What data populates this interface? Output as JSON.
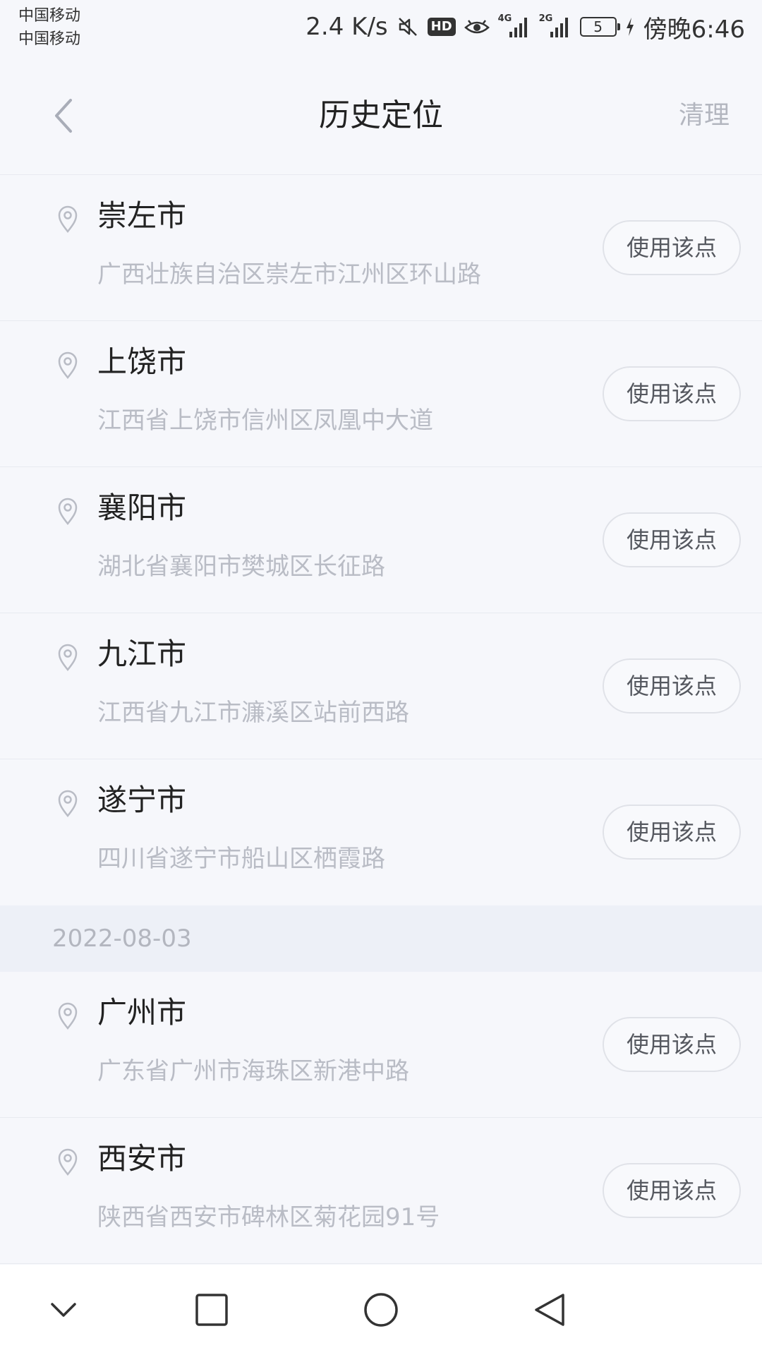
{
  "status_bar": {
    "carrier_1": "中国移动",
    "carrier_2": "中国移动",
    "network_speed": "2.4 K/s",
    "hd_label": "HD",
    "signal_1_label": "4G",
    "signal_2_label": "2G",
    "battery_level": "5",
    "time": "傍晚6:46",
    "icons": [
      "mute-icon",
      "hd-icon",
      "eye-icon",
      "signal-4g-icon",
      "signal-2g-icon",
      "battery-icon",
      "charging-icon"
    ]
  },
  "header": {
    "title": "历史定位",
    "clear_label": "清理",
    "back_icon": "chevron-left-icon"
  },
  "use_button_label": "使用该点",
  "locations_group_1": [
    {
      "name": "崇左市",
      "address": "广西壮族自治区崇左市江州区环山路"
    },
    {
      "name": "上饶市",
      "address": "江西省上饶市信州区凤凰中大道"
    },
    {
      "name": "襄阳市",
      "address": "湖北省襄阳市樊城区长征路"
    },
    {
      "name": "九江市",
      "address": "江西省九江市濂溪区站前西路"
    },
    {
      "name": "遂宁市",
      "address": "四川省遂宁市船山区栖霞路"
    }
  ],
  "date_header": "2022-08-03",
  "locations_group_2": [
    {
      "name": "广州市",
      "address": "广东省广州市海珠区新港中路"
    },
    {
      "name": "西安市",
      "address": "陕西省西安市碑林区菊花园91号"
    }
  ],
  "nav_bar": {
    "icons": [
      "chevron-down-icon",
      "square-icon",
      "circle-icon",
      "triangle-back-icon"
    ]
  },
  "colors": {
    "background": "#f6f7fb",
    "date_header_bg": "#edf0f7",
    "primary_text": "#222222",
    "secondary_text": "#b9bcc5",
    "button_border": "#e0e2e8"
  }
}
